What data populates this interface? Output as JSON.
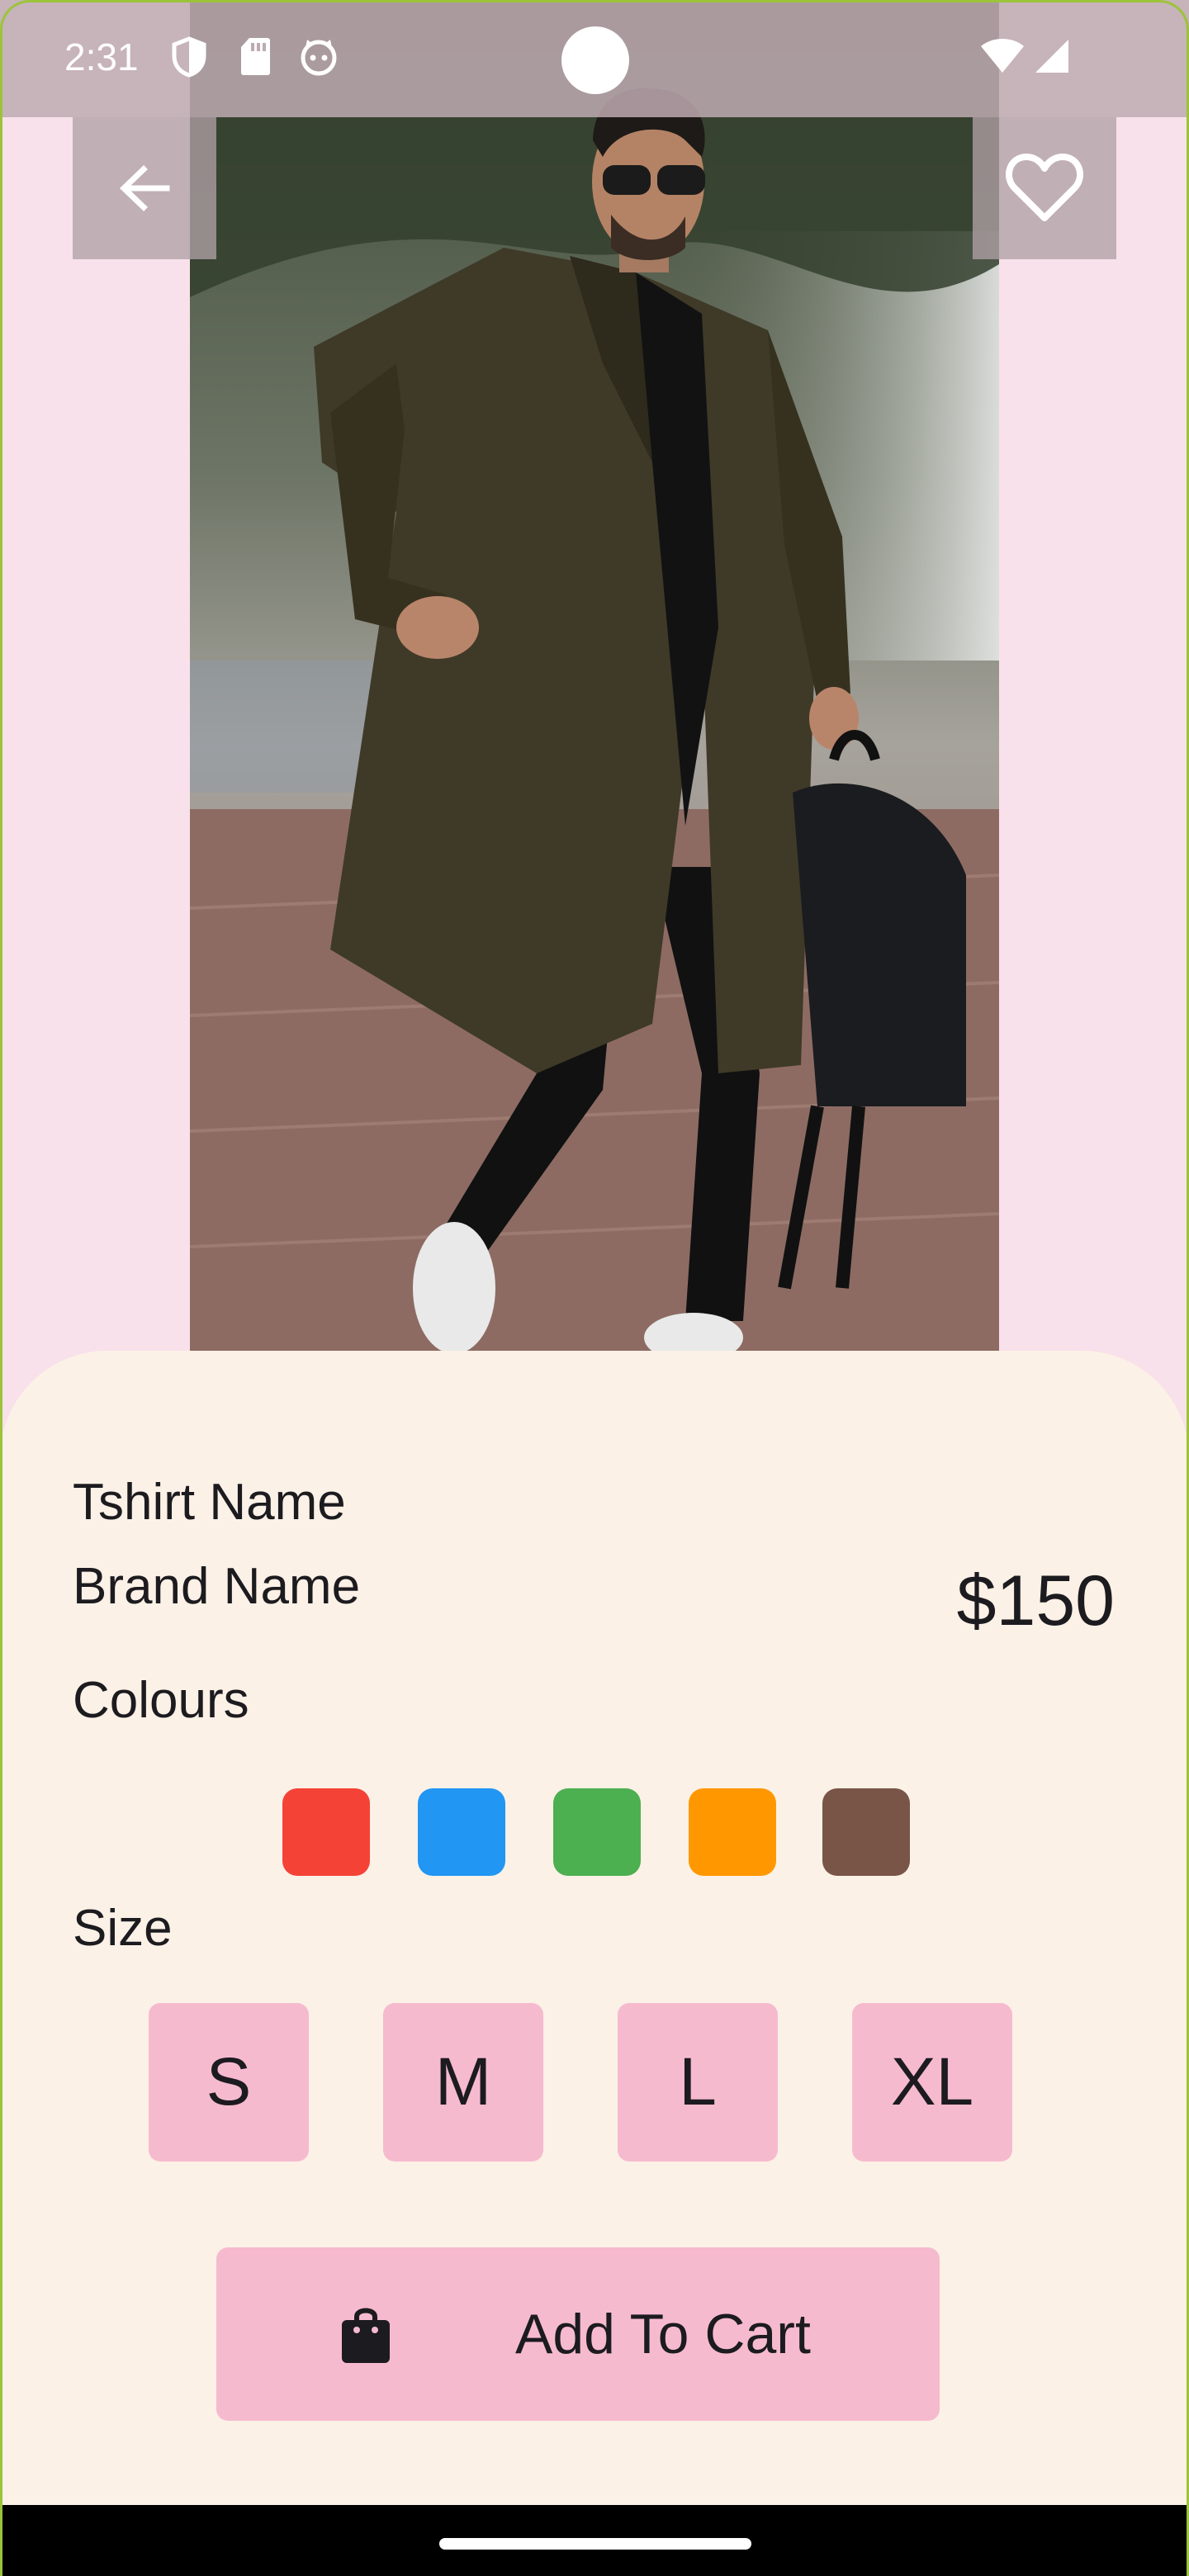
{
  "status_bar": {
    "time": "2:31"
  },
  "product": {
    "name": "Tshirt Name",
    "brand": "Brand Name",
    "price": "$150",
    "photo_description": "man in long olive coat with black backpack"
  },
  "colours": {
    "label": "Colours",
    "options": [
      {
        "name": "red",
        "hex": "#f44336"
      },
      {
        "name": "blue",
        "hex": "#2196f3"
      },
      {
        "name": "green",
        "hex": "#4caf50"
      },
      {
        "name": "orange",
        "hex": "#ff9800"
      },
      {
        "name": "brown",
        "hex": "#795548"
      }
    ]
  },
  "sizes": {
    "label": "Size",
    "options": [
      "S",
      "M",
      "L",
      "XL"
    ]
  },
  "cart": {
    "label": "Add To Cart"
  },
  "theme": {
    "background": "#f8e1ea",
    "sheet": "#fcf1e6",
    "button": "#f6bacf"
  }
}
